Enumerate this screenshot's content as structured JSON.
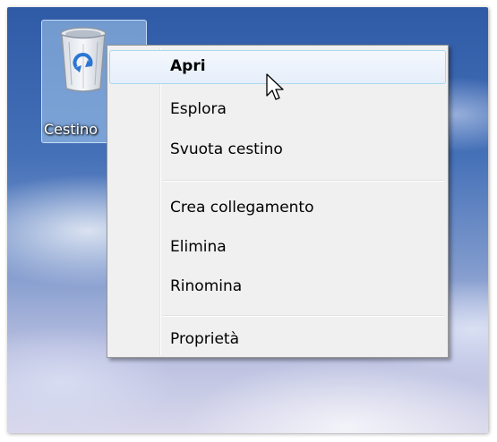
{
  "desktop": {
    "recycle_bin": {
      "label": "Cestino",
      "icon": "recycle-bin-icon"
    }
  },
  "context_menu": {
    "items": [
      {
        "label": "Apri",
        "default": true,
        "hovered": true
      },
      {
        "label": "Esplora"
      },
      {
        "label": "Svuota cestino"
      },
      {
        "label": "Crea collegamento"
      },
      {
        "label": "Elimina"
      },
      {
        "label": "Rinomina"
      },
      {
        "label": "Proprietà"
      }
    ]
  },
  "colors": {
    "menu_background": "#f0f0f0",
    "menu_border": "#979797",
    "hover_border": "#a8d8eb",
    "selection_highlight": "rgba(170,205,240,0.55)"
  },
  "cursor": {
    "icon": "arrow-cursor-icon"
  }
}
